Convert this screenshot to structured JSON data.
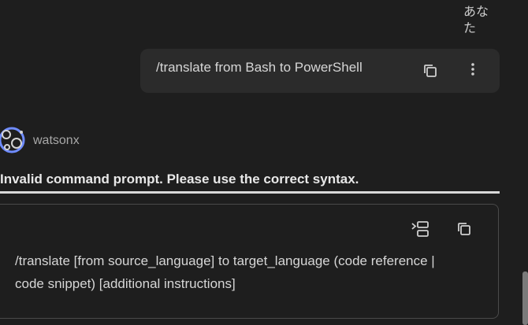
{
  "user": {
    "name": "あなた",
    "message": "/translate from Bash to PowerShell"
  },
  "assistant": {
    "name": "watsonx",
    "error": "Invalid command prompt. Please use the correct syntax.",
    "code_block": "/translate [from source_language] to target_language (code reference | code snippet) [additional instructions]"
  },
  "icons": {
    "user_copy": "copy-icon",
    "user_more": "more-vertical-icon",
    "insert": "insert-code-icon",
    "code_copy": "copy-icon",
    "avatar": "watsonx-logo"
  },
  "colors": {
    "background": "#1e1e1e",
    "bubble": "#2b2b2b",
    "avatar_blue": "#6f8cff"
  }
}
